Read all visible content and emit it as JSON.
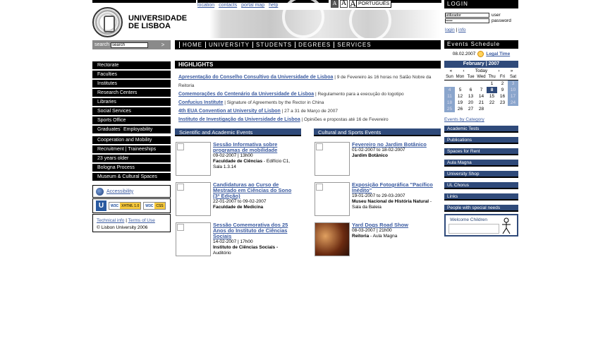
{
  "header": {
    "university_name_line1": "UNIVERSIDADE",
    "university_name_line2": "DE LISBOA",
    "top_links": [
      "location",
      "contacts",
      "portal map",
      "help"
    ],
    "font_buttons": [
      "A",
      "A",
      "A"
    ],
    "language_button": "PORTUGUÊS"
  },
  "search": {
    "label": "search",
    "value": "search",
    "go": ">"
  },
  "main_nav": [
    "HOME",
    "UNIVERSITY",
    "STUDENTS",
    "DEGREES",
    "SERVICES"
  ],
  "left_menu": {
    "group1": [
      "Rectorate",
      "Faculties",
      "Institutes",
      "Research Centers",
      "Libraries",
      "Social Services",
      "Sports Office",
      "Graduates´ Employability"
    ],
    "group2": [
      "Cooperation and Mobility",
      "Recruitment | Traineeships",
      "23 years older",
      "Bologna Process",
      "Museum & Cultural Spaces"
    ]
  },
  "accessibility": {
    "label": "Accessibility"
  },
  "badges": {
    "u": "U",
    "xhtml_w": "W3C",
    "xhtml": "XHTML 1.0",
    "css_w": "W3C",
    "css": "CSS"
  },
  "footer": {
    "technical_info": "Technical info",
    "terms": "Terms of Use",
    "copyright": "© Lisbon University 2006"
  },
  "highlights": {
    "title": "HIGHLIGHTS",
    "items": [
      {
        "link": "Apresentação do Conselho Consultivo da Universidade de Lisboa",
        "text": "| 9 de Fevereiro às 16 horas no Salão Nobre da Reitoria"
      },
      {
        "link": "Comemorações do Centenário da Universidade de Lisboa",
        "text": "| Regulamento para a execução do logotipo"
      },
      {
        "link": "Confucius Institute",
        "text": "| Signature of Agreements by the Rector in China"
      },
      {
        "link": "4th EUA Convention at University of Lisbon",
        "text": "| 27 a 31 de Março de 2007"
      },
      {
        "link": "Instituto de Investigação da Universidade de Lisboa",
        "text": "| Opiniões e propostas até 16 de Fevereiro"
      }
    ]
  },
  "scientific": {
    "title": "Scientific and Academic Events",
    "events": [
      {
        "title": "Sessão Informativa sobre programas de mobilidade",
        "date": "09-02-2007 | 13h00",
        "place": "Faculdade de Ciências",
        "detail": "- Edifício C1, Sala 1.3.14"
      },
      {
        "title": "Candidaturas ao Curso de Mestrado em Ciências do Sono (3ª Edição)",
        "date": "22-01-2007 to 09-02-2007",
        "place": "Faculdade de Medicina",
        "detail": ""
      },
      {
        "title": "Sessão Comemorativa dos 25 Anos do Instituto de Ciências Sociais",
        "date": "14-02-2007 | 17h00",
        "place": "Instituto de Ciências Sociais -",
        "detail": "Auditório"
      }
    ]
  },
  "cultural": {
    "title": "Cultural and Sports Events",
    "events": [
      {
        "title": "Fevereiro no Jardim Botânico",
        "date": "01-02-2007 to 18-02-2007",
        "place": "Jardim Botânico",
        "detail": ""
      },
      {
        "title": "Exposição Fotográfica \"Pacífico Inédito\"",
        "date": "19-01-2007 to 29-03-2007",
        "place": "Museu Nacional de História Natural",
        "detail": "- Sala da Baleia"
      },
      {
        "title": "Yard Dogs Road Show",
        "date": "08-03-2007 | 21h00",
        "place": "Reitoria",
        "detail": "- Aula Magna"
      }
    ]
  },
  "login": {
    "title": "LOGIN",
    "user_value": "utilizador",
    "user_label": "user",
    "password_value": "•••••",
    "password_label": "password",
    "login_link": "login",
    "info_link": "info"
  },
  "events_schedule": {
    "title": "Events Schedule",
    "date": "08.02.2007",
    "legal_time": "Legal Time"
  },
  "calendar": {
    "month": "February | 2007",
    "nav": [
      "«",
      "‹",
      "Today",
      "›",
      "»"
    ],
    "day_headers": [
      "Sun",
      "Mon",
      "Tue",
      "Wed",
      "Thu",
      "Fri",
      "Sat"
    ],
    "weeks": [
      [
        "",
        "",
        "",
        "",
        "1",
        "2",
        "3"
      ],
      [
        "4",
        "5",
        "6",
        "7",
        "8",
        "9",
        "10"
      ],
      [
        "11",
        "12",
        "13",
        "14",
        "15",
        "16",
        "17"
      ],
      [
        "18",
        "19",
        "20",
        "21",
        "22",
        "23",
        "24"
      ],
      [
        "25",
        "26",
        "27",
        "28",
        "",
        "",
        ""
      ]
    ],
    "today": "8",
    "by_category": "Events by Category"
  },
  "right_links": [
    "Academic Tests",
    "Publications",
    "Spaces for Rent",
    "Aula Magna",
    "University Shop",
    "UL Chorus",
    "Links",
    "People with special needs"
  ],
  "welcome": {
    "label": "Welcome Children"
  }
}
